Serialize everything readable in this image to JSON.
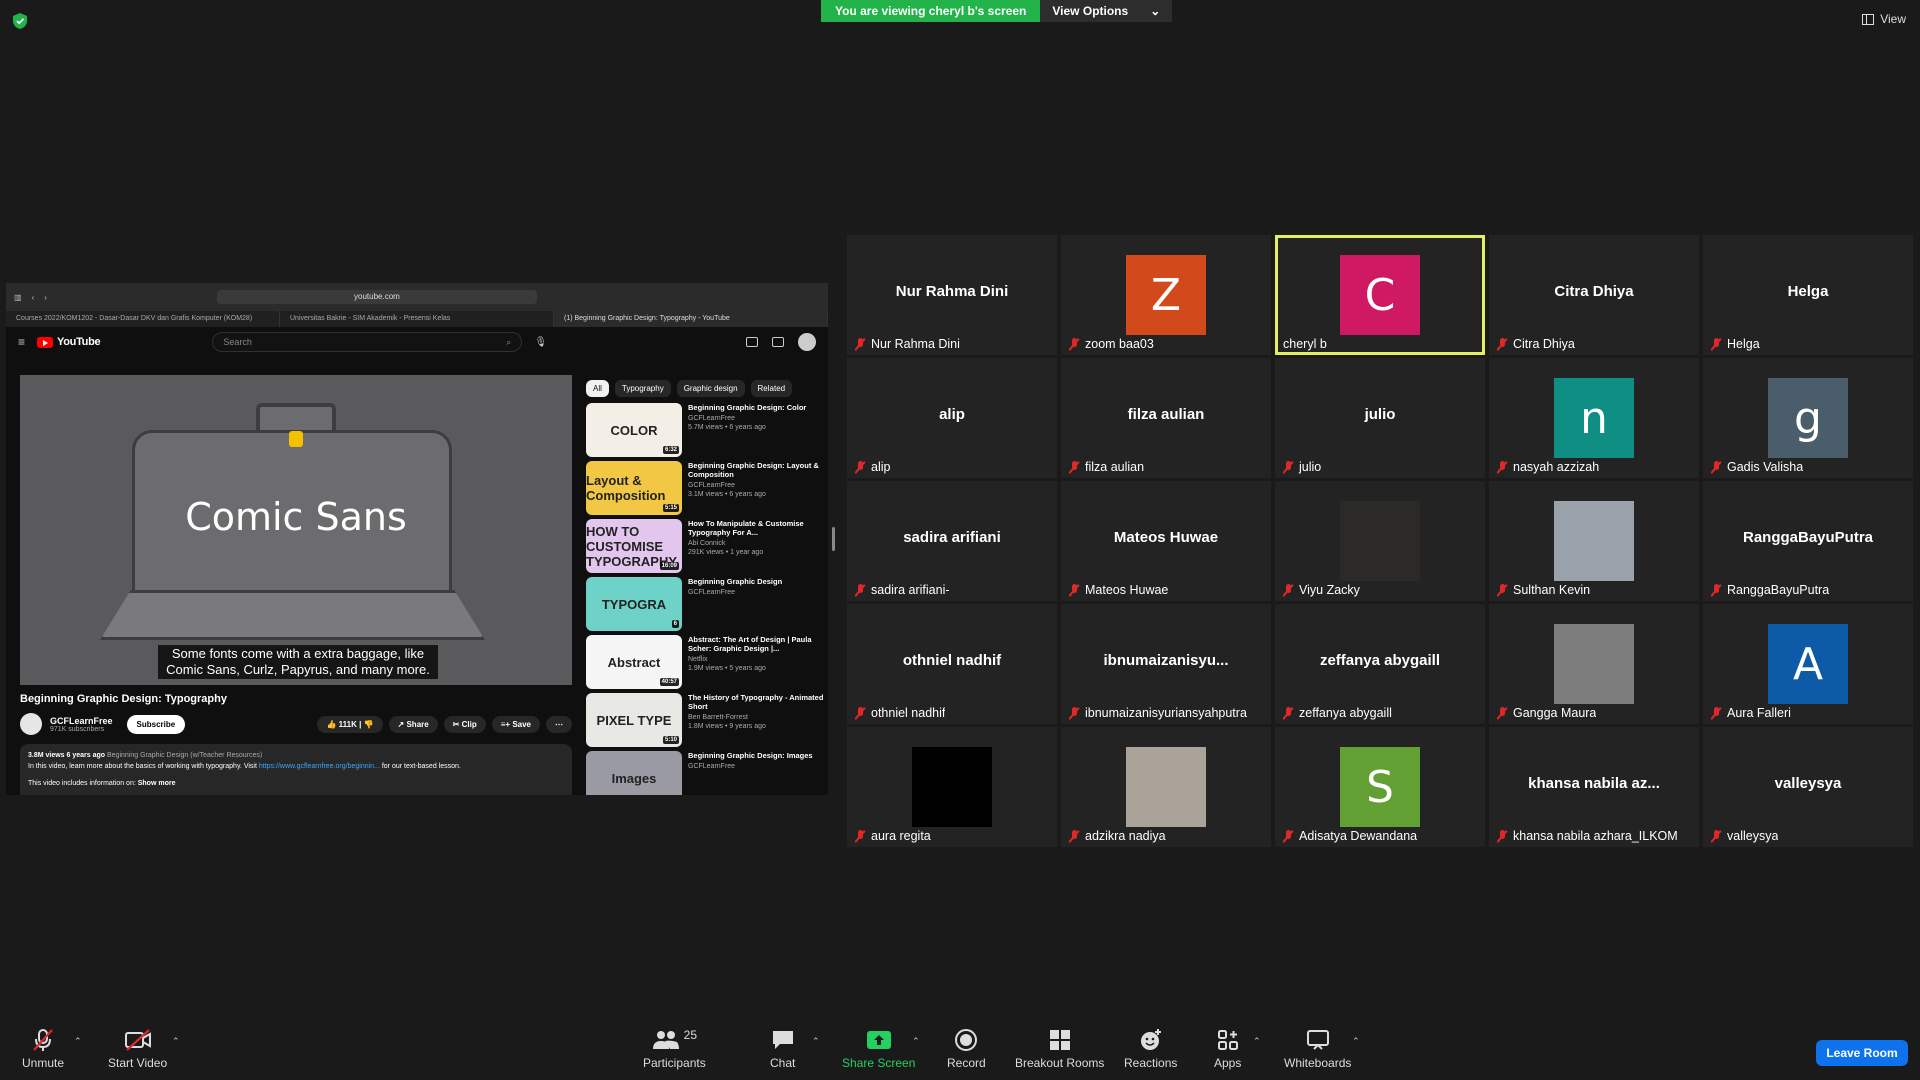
{
  "banner": {
    "text": "You are viewing cheryl b's screen",
    "view_options": "View Options",
    "caret": "⌄"
  },
  "top_view": {
    "label": "View"
  },
  "browser": {
    "address": "youtube.com",
    "tabs": [
      {
        "label": "Courses 2022/KOM1202 - Dasar-Dasar DKV dan Grafis Komputer (KOM28)",
        "active": false
      },
      {
        "label": "Universitas Bakrie - SIM Akademik - Presensi Kelas",
        "active": false
      },
      {
        "label": "(1) Beginning Graphic Design: Typography - YouTube",
        "active": true
      }
    ]
  },
  "youtube": {
    "logo": "YouTube",
    "search_placeholder": "Search",
    "video_overlay_title": "Comic Sans",
    "caption_line1": "Some fonts come with a extra baggage, like",
    "caption_line2": "Comic Sans, Curlz, Papyrus, and many more.",
    "title": "Beginning Graphic Design: Typography",
    "channel": "GCFLearnFree",
    "subscribers": "971K subscribers",
    "subscribe": "Subscribe",
    "likes": "111K",
    "share": "Share",
    "clip": "Clip",
    "save": "Save",
    "desc_views": "3.8M views  6 years ago",
    "desc_playlist": "Beginning Graphic Design (w/Teacher Resources)",
    "desc_line": "In this video, learn more about the basics of working with typography. Visit",
    "desc_link": "https://www.gcflearnfree.org/beginnin...",
    "desc_line_end": "for our text-based lesson.",
    "desc_line2": "This video includes information on:",
    "show_more": "Show more",
    "chips": [
      "All",
      "Typography",
      "Graphic design",
      "Related"
    ],
    "recommendations": [
      {
        "thumb": "COLOR",
        "thumb_bg": "#f3efe6",
        "duration": "6:32",
        "title": "Beginning Graphic Design: Color",
        "channel": "GCFLearnFree",
        "stats": "5.7M views • 6 years ago"
      },
      {
        "thumb": "Layout & Composition",
        "thumb_bg": "#f2c744",
        "duration": "5:15",
        "title": "Beginning Graphic Design: Layout & Composition",
        "channel": "GCFLearnFree",
        "stats": "3.1M views • 6 years ago"
      },
      {
        "thumb": "HOW TO CUSTOMISE TYPOGRAPHY",
        "thumb_bg": "#e3c6ee",
        "duration": "16:09",
        "title": "How To Manipulate & Customise Typography For A...",
        "channel": "Abi Connick",
        "stats": "291K views • 1 year ago"
      },
      {
        "thumb": "TYPOGRA",
        "thumb_bg": "#6fd2c8",
        "duration": "6",
        "title": "Beginning Graphic Design",
        "channel": "GCFLearnFree",
        "stats": ""
      },
      {
        "thumb": "Abstract",
        "thumb_bg": "#f5f5f5",
        "duration": "40:57",
        "title": "Abstract: The Art of Design | Paula Scher: Graphic Design |...",
        "channel": "Netflix",
        "stats": "1.9M views • 5 years ago"
      },
      {
        "thumb": "PIXEL TYPE",
        "thumb_bg": "#e8e8e4",
        "duration": "5:10",
        "title": "The History of Typography - Animated Short",
        "channel": "Ben Barrett-Forrest",
        "stats": "1.8M views • 9 years ago"
      },
      {
        "thumb": "Images",
        "thumb_bg": "#9a9aa4",
        "duration": "",
        "title": "Beginning Graphic Design: Images",
        "channel": "GCFLearnFree",
        "stats": ""
      }
    ]
  },
  "participants": [
    {
      "display": "Nur Rahma Dini",
      "label": "Nur Rahma Dini",
      "type": "name"
    },
    {
      "display": "Z",
      "label": "zoom baa03",
      "type": "avatar",
      "color": "#d2491c"
    },
    {
      "display": "C",
      "label": "cheryl b",
      "type": "avatar",
      "color": "#cf1a63",
      "speaking": true
    },
    {
      "display": "Citra Dhiya",
      "label": "Citra Dhiya",
      "type": "name"
    },
    {
      "display": "Helga",
      "label": "Helga",
      "type": "name"
    },
    {
      "display": "alip",
      "label": "alip",
      "type": "name"
    },
    {
      "display": "filza aulian",
      "label": "filza aulian",
      "type": "name"
    },
    {
      "display": "julio",
      "label": "julio",
      "type": "name"
    },
    {
      "display": "n",
      "label": "nasyah azzizah",
      "type": "avatar",
      "color": "#0f8f84"
    },
    {
      "display": "g",
      "label": "Gadis Valisha",
      "type": "avatar",
      "color": "#4a5d6b"
    },
    {
      "display": "sadira arifiani",
      "label": "sadira arifiani-",
      "type": "name"
    },
    {
      "display": "Mateos Huwae",
      "label": "Mateos Huwae",
      "type": "name"
    },
    {
      "display": "",
      "label": "Viyu Zacky",
      "type": "photo",
      "color": "#2b2a27"
    },
    {
      "display": "",
      "label": "Sulthan Kevin",
      "type": "photo",
      "color": "#9aa3ab"
    },
    {
      "display": "RanggaBayuPutra",
      "label": "RanggaBayuPutra",
      "type": "name"
    },
    {
      "display": "othniel nadhif",
      "label": "othniel nadhif",
      "type": "name"
    },
    {
      "display": "ibnumaizanisyu...",
      "label": "ibnumaizanisyuriansyahputra",
      "type": "name"
    },
    {
      "display": "zeffanya abygaill",
      "label": "zeffanya abygaill",
      "type": "name"
    },
    {
      "display": "",
      "label": "Gangga Maura",
      "type": "photo",
      "color": "#7d7d7d"
    },
    {
      "display": "A",
      "label": "Aura Falleri",
      "type": "avatar",
      "color": "#0d5aa7"
    },
    {
      "display": "",
      "label": "aura regita",
      "type": "photo",
      "color": "#000000"
    },
    {
      "display": "",
      "label": "adzikra nadiya",
      "type": "photo",
      "color": "#a9a39a"
    },
    {
      "display": "S",
      "label": "Adisatya Dewandana",
      "type": "avatar",
      "color": "#62a033"
    },
    {
      "display": "khansa nabila az...",
      "label": "khansa nabila azhara_ILKOM",
      "type": "name"
    },
    {
      "display": "valleysya",
      "label": "valleysya",
      "type": "name"
    }
  ],
  "toolbar": {
    "unmute": "Unmute",
    "start_video": "Start Video",
    "participants": "Participants",
    "participants_count": "25",
    "chat": "Chat",
    "share_screen": "Share Screen",
    "record": "Record",
    "breakout_rooms": "Breakout Rooms",
    "reactions": "Reactions",
    "apps": "Apps",
    "whiteboards": "Whiteboards",
    "leave": "Leave Room"
  }
}
